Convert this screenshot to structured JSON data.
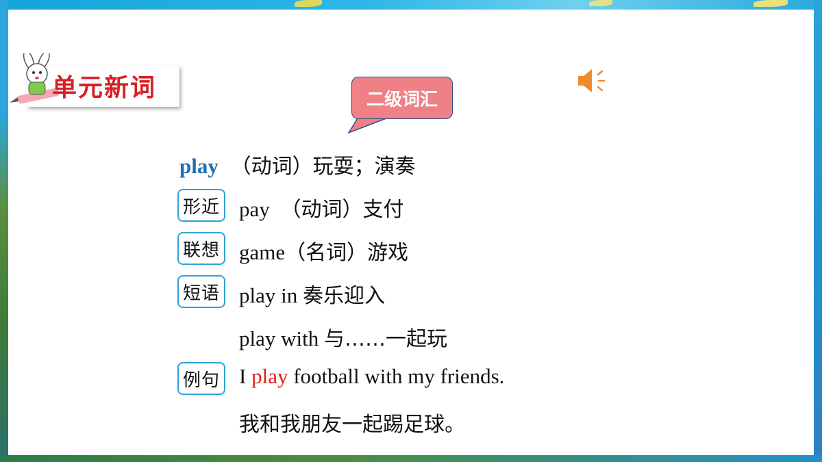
{
  "header": {
    "section_title": "单元新词",
    "level_bubble": "二级词汇"
  },
  "icons": {
    "mascot": "rabbit-pencil-mascot-icon",
    "audio": "speaker-icon"
  },
  "colors": {
    "title_red": "#d81f26",
    "headword_blue": "#1e6fb4",
    "tag_border": "#2ba3d8",
    "bubble_pink": "#ee8086",
    "highlight_red": "#e0201b"
  },
  "entry": {
    "headword": "play",
    "definition": "（动词）玩耍；演奏",
    "similar": {
      "tag": "形近",
      "word": "pay",
      "meaning": "（动词）支付"
    },
    "association": {
      "tag": "联想",
      "word": "game",
      "meaning": "（名词）游戏"
    },
    "phrases": {
      "tag": "短语",
      "items": [
        {
          "en": "play in",
          "cn": "奏乐迎入"
        },
        {
          "en": "play with",
          "cn": "与……一起玩"
        }
      ]
    },
    "example": {
      "tag": "例句",
      "before": "I",
      "highlight": "play",
      "after": "football with my friends.",
      "translation": "我和我朋友一起踢足球。"
    }
  }
}
